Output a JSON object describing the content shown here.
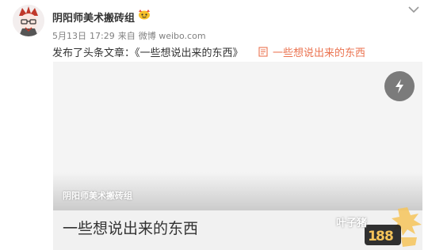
{
  "post": {
    "username": "阴阳师美术搬砖组",
    "meta": {
      "date": "5月13日",
      "time": "17:29",
      "source_prefix": "来自",
      "source": "微博 weibo.com"
    },
    "text": "发布了头条文章：《一些想说出来的东西》",
    "article_link_label": "一些想说出来的东西"
  },
  "card": {
    "cover_author": "阴阳师美术搬砖组",
    "title": "一些想说出来的东西"
  },
  "watermark": {
    "text": "叶子猪"
  },
  "icons": {
    "avatar": "avatar-illustration",
    "vip_badge": "vip-badge-icon",
    "chevron": "chevron-down-icon",
    "doc": "document-icon",
    "bolt": "lightning-icon"
  },
  "colors": {
    "link": "#eb7350",
    "meta_text": "#808080",
    "card_bg": "#f1f1f1",
    "bolt_bg": "#7b7b7b"
  }
}
